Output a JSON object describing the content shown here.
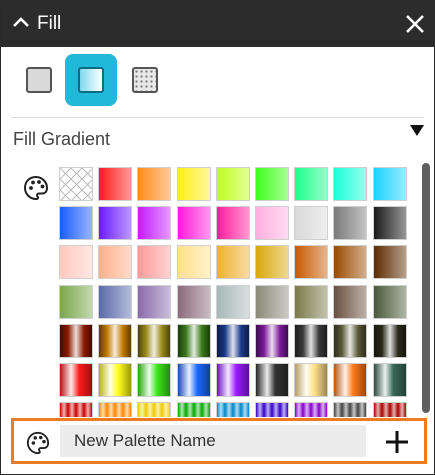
{
  "panel": {
    "title": "Fill",
    "fill_types": [
      {
        "name": "solid",
        "selected": false
      },
      {
        "name": "gradient",
        "selected": true
      },
      {
        "name": "pattern",
        "selected": false
      }
    ],
    "section_label": "Fill Gradient"
  },
  "colors": {
    "titlebar": "#2c2c2c",
    "selected_accent": "#22b8d9",
    "highlight_border": "#ee7b22"
  },
  "swatches": [
    [
      "none",
      "#ff1a1a",
      "#ff8a1a",
      "#ffee1a",
      "#bfff1a",
      "#3dff1a",
      "#1aff8a",
      "#1affd9",
      "#1ad4ff"
    ],
    [
      "#1a5cff",
      "#6b1aff",
      "#c21aff",
      "#ff1ad9",
      "#ff1a9c",
      "#ffb0df",
      "#d9d9d9",
      "#7a7a7a",
      "#1a1a1a"
    ],
    [
      "#ffc9bf",
      "#ffb08a",
      "#ff9a9a",
      "#ffe08a",
      "#f0b030",
      "#d9a80a",
      "#c85a00",
      "#9a4a00",
      "#5c2a00"
    ],
    [
      "#7aa84a",
      "#5a6aaa",
      "#8a6aaa",
      "#8a6a7a",
      "#a8b8b8",
      "#8a8a7a",
      "#7a7a4a",
      "#6a5040",
      "#4a5a3a"
    ],
    [
      "#8a1a00",
      "#c07a00",
      "#9a8a1a",
      "#3a7a1a",
      "#1a3a8a",
      "#7a1a9a",
      "#3a3a3a",
      "#5a5a3a",
      "#2a2a1a"
    ],
    [
      "#ff1a1a",
      "#ffff1a",
      "#3ae61a",
      "#1a6aff",
      "#9a1aff",
      "#333333",
      "#ffe08a",
      "#ff7a1a",
      "#3a6a5a"
    ],
    [
      "#cc0000",
      "#ff8800",
      "#eecc00",
      "#00aa00",
      "#0088cc",
      "#3300cc",
      "#8800cc",
      "#444444",
      "#aa0000"
    ]
  ],
  "new_palette": {
    "placeholder": "New Palette Name"
  },
  "icons": {
    "collapse": "chevron-up-icon",
    "close": "close-icon",
    "dropdown": "triangle-down-icon",
    "palette": "palette-icon",
    "add": "plus-icon"
  }
}
